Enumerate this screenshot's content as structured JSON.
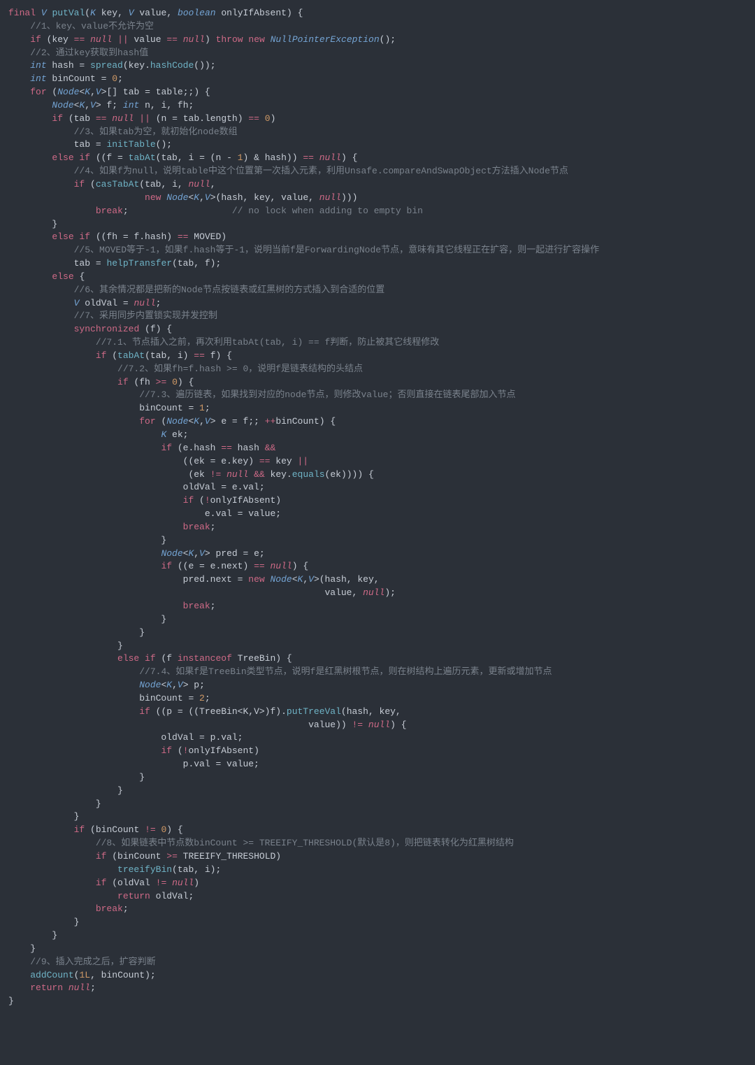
{
  "code_tokens": [
    [
      [
        "kw",
        "final"
      ],
      [
        "p",
        " "
      ],
      [
        "ty",
        "V"
      ],
      [
        "p",
        " "
      ],
      [
        "fn",
        "putVal"
      ],
      [
        "p",
        "("
      ],
      [
        "ty",
        "K"
      ],
      [
        "p",
        " key, "
      ],
      [
        "ty",
        "V"
      ],
      [
        "p",
        " value, "
      ],
      [
        "ty",
        "boolean"
      ],
      [
        "p",
        " onlyIfAbsent) {"
      ]
    ],
    [
      [
        "p",
        "    "
      ],
      [
        "cm",
        "//1、key、value不允许为空"
      ]
    ],
    [
      [
        "p",
        "    "
      ],
      [
        "kw",
        "if"
      ],
      [
        "p",
        " (key "
      ],
      [
        "op",
        "=="
      ],
      [
        "p",
        " "
      ],
      [
        "nul",
        "null"
      ],
      [
        "p",
        " "
      ],
      [
        "op",
        "||"
      ],
      [
        "p",
        " value "
      ],
      [
        "op",
        "=="
      ],
      [
        "p",
        " "
      ],
      [
        "nul",
        "null"
      ],
      [
        "p",
        ") "
      ],
      [
        "kw",
        "throw"
      ],
      [
        "p",
        " "
      ],
      [
        "kw",
        "new"
      ],
      [
        "p",
        " "
      ],
      [
        "ty",
        "NullPointerException"
      ],
      [
        "p",
        "();"
      ]
    ],
    [
      [
        "p",
        "    "
      ],
      [
        "cm",
        "//2、通过key获取到hash值"
      ]
    ],
    [
      [
        "p",
        "    "
      ],
      [
        "ty",
        "int"
      ],
      [
        "p",
        " hash = "
      ],
      [
        "fn",
        "spread"
      ],
      [
        "p",
        "(key."
      ],
      [
        "fn",
        "hashCode"
      ],
      [
        "p",
        "());"
      ]
    ],
    [
      [
        "p",
        "    "
      ],
      [
        "ty",
        "int"
      ],
      [
        "p",
        " binCount = "
      ],
      [
        "num",
        "0"
      ],
      [
        "p",
        ";"
      ]
    ],
    [
      [
        "p",
        "    "
      ],
      [
        "kw",
        "for"
      ],
      [
        "p",
        " ("
      ],
      [
        "ty",
        "Node"
      ],
      [
        "p",
        "<"
      ],
      [
        "ty",
        "K"
      ],
      [
        "p",
        ","
      ],
      [
        "ty",
        "V"
      ],
      [
        "p",
        ">[] tab = table;;) {"
      ]
    ],
    [
      [
        "p",
        "        "
      ],
      [
        "ty",
        "Node"
      ],
      [
        "p",
        "<"
      ],
      [
        "ty",
        "K"
      ],
      [
        "p",
        ","
      ],
      [
        "ty",
        "V"
      ],
      [
        "p",
        "> f; "
      ],
      [
        "ty",
        "int"
      ],
      [
        "p",
        " n, i, fh;"
      ]
    ],
    [
      [
        "p",
        "        "
      ],
      [
        "kw",
        "if"
      ],
      [
        "p",
        " (tab "
      ],
      [
        "op",
        "=="
      ],
      [
        "p",
        " "
      ],
      [
        "nul",
        "null"
      ],
      [
        "p",
        " "
      ],
      [
        "op",
        "||"
      ],
      [
        "p",
        " (n = tab.length) "
      ],
      [
        "op",
        "=="
      ],
      [
        "p",
        " "
      ],
      [
        "num",
        "0"
      ],
      [
        "p",
        ")"
      ]
    ],
    [
      [
        "p",
        "            "
      ],
      [
        "cm",
        "//3、如果tab为空，就初始化node数组"
      ]
    ],
    [
      [
        "p",
        "            tab = "
      ],
      [
        "fn",
        "initTable"
      ],
      [
        "p",
        "();"
      ]
    ],
    [
      [
        "p",
        "        "
      ],
      [
        "kw",
        "else if"
      ],
      [
        "p",
        " ((f = "
      ],
      [
        "fn",
        "tabAt"
      ],
      [
        "p",
        "(tab, i = (n - "
      ],
      [
        "num",
        "1"
      ],
      [
        "p",
        ") & hash)) "
      ],
      [
        "op",
        "=="
      ],
      [
        "p",
        " "
      ],
      [
        "nul",
        "null"
      ],
      [
        "p",
        ") {"
      ]
    ],
    [
      [
        "p",
        "            "
      ],
      [
        "cm",
        "//4、如果f为null，说明table中这个位置第一次插入元素，利用Unsafe.compareAndSwapObject方法插入Node节点"
      ]
    ],
    [
      [
        "p",
        "            "
      ],
      [
        "kw",
        "if"
      ],
      [
        "p",
        " ("
      ],
      [
        "fn",
        "casTabAt"
      ],
      [
        "p",
        "(tab, i, "
      ],
      [
        "nul",
        "null"
      ],
      [
        "p",
        ","
      ]
    ],
    [
      [
        "p",
        "                         "
      ],
      [
        "kw",
        "new"
      ],
      [
        "p",
        " "
      ],
      [
        "ty",
        "Node"
      ],
      [
        "p",
        "<"
      ],
      [
        "ty",
        "K"
      ],
      [
        "p",
        ","
      ],
      [
        "ty",
        "V"
      ],
      [
        "p",
        ">(hash, key, value, "
      ],
      [
        "nul",
        "null"
      ],
      [
        "p",
        ")))"
      ]
    ],
    [
      [
        "p",
        "                "
      ],
      [
        "kw",
        "break"
      ],
      [
        "p",
        ";                   "
      ],
      [
        "cm",
        "// no lock when adding to empty bin"
      ]
    ],
    [
      [
        "p",
        "        }"
      ]
    ],
    [
      [
        "p",
        "        "
      ],
      [
        "kw",
        "else if"
      ],
      [
        "p",
        " ((fh = f.hash) "
      ],
      [
        "op",
        "=="
      ],
      [
        "p",
        " MOVED)"
      ]
    ],
    [
      [
        "p",
        "            "
      ],
      [
        "cm",
        "//5、MOVED等于-1，如果f.hash等于-1，说明当前f是ForwardingNode节点，意味有其它线程正在扩容，则一起进行扩容操作"
      ]
    ],
    [
      [
        "p",
        "            tab = "
      ],
      [
        "fn",
        "helpTransfer"
      ],
      [
        "p",
        "(tab, f);"
      ]
    ],
    [
      [
        "p",
        "        "
      ],
      [
        "kw",
        "else"
      ],
      [
        "p",
        " {"
      ]
    ],
    [
      [
        "p",
        "            "
      ],
      [
        "cm",
        "//6、其余情况都是把新的Node节点按链表或红黑树的方式插入到合适的位置"
      ]
    ],
    [
      [
        "p",
        "            "
      ],
      [
        "ty",
        "V"
      ],
      [
        "p",
        " oldVal = "
      ],
      [
        "nul",
        "null"
      ],
      [
        "p",
        ";"
      ]
    ],
    [
      [
        "p",
        "            "
      ],
      [
        "cm",
        "//7、采用同步内置锁实现并发控制"
      ]
    ],
    [
      [
        "p",
        "            "
      ],
      [
        "kw",
        "synchronized"
      ],
      [
        "p",
        " (f) {"
      ]
    ],
    [
      [
        "p",
        "                "
      ],
      [
        "cm",
        "//7.1、节点插入之前，再次利用tabAt(tab, i) == f判断，防止被其它线程修改"
      ]
    ],
    [
      [
        "p",
        "                "
      ],
      [
        "kw",
        "if"
      ],
      [
        "p",
        " ("
      ],
      [
        "fn",
        "tabAt"
      ],
      [
        "p",
        "(tab, i) "
      ],
      [
        "op",
        "=="
      ],
      [
        "p",
        " f) {"
      ]
    ],
    [
      [
        "p",
        "                    "
      ],
      [
        "cm",
        "//7.2、如果fh=f.hash >= 0，说明f是链表结构的头结点"
      ]
    ],
    [
      [
        "p",
        "                    "
      ],
      [
        "kw",
        "if"
      ],
      [
        "p",
        " (fh "
      ],
      [
        "op",
        ">="
      ],
      [
        "p",
        " "
      ],
      [
        "num",
        "0"
      ],
      [
        "p",
        ") {"
      ]
    ],
    [
      [
        "p",
        "                        "
      ],
      [
        "cm",
        "//7.3、遍历链表，如果找到对应的node节点，则修改value；否则直接在链表尾部加入节点"
      ]
    ],
    [
      [
        "p",
        "                        binCount = "
      ],
      [
        "num",
        "1"
      ],
      [
        "p",
        ";"
      ]
    ],
    [
      [
        "p",
        "                        "
      ],
      [
        "kw",
        "for"
      ],
      [
        "p",
        " ("
      ],
      [
        "ty",
        "Node"
      ],
      [
        "p",
        "<"
      ],
      [
        "ty",
        "K"
      ],
      [
        "p",
        ","
      ],
      [
        "ty",
        "V"
      ],
      [
        "p",
        "> e = f;; "
      ],
      [
        "op",
        "++"
      ],
      [
        "p",
        "binCount) {"
      ]
    ],
    [
      [
        "p",
        "                            "
      ],
      [
        "ty",
        "K"
      ],
      [
        "p",
        " ek;"
      ]
    ],
    [
      [
        "p",
        "                            "
      ],
      [
        "kw",
        "if"
      ],
      [
        "p",
        " (e.hash "
      ],
      [
        "op",
        "=="
      ],
      [
        "p",
        " hash "
      ],
      [
        "op",
        "&&"
      ]
    ],
    [
      [
        "p",
        "                                ((ek = e.key) "
      ],
      [
        "op",
        "=="
      ],
      [
        "p",
        " key "
      ],
      [
        "op",
        "||"
      ]
    ],
    [
      [
        "p",
        "                                 (ek "
      ],
      [
        "op",
        "!="
      ],
      [
        "p",
        " "
      ],
      [
        "nul",
        "null"
      ],
      [
        "p",
        " "
      ],
      [
        "op",
        "&&"
      ],
      [
        "p",
        " key."
      ],
      [
        "fn",
        "equals"
      ],
      [
        "p",
        "(ek)))) {"
      ]
    ],
    [
      [
        "p",
        "                                oldVal = e.val;"
      ]
    ],
    [
      [
        "p",
        "                                "
      ],
      [
        "kw",
        "if"
      ],
      [
        "p",
        " ("
      ],
      [
        "op",
        "!"
      ],
      [
        "p",
        "onlyIfAbsent)"
      ]
    ],
    [
      [
        "p",
        "                                    e.val = value;"
      ]
    ],
    [
      [
        "p",
        "                                "
      ],
      [
        "kw",
        "break"
      ],
      [
        "p",
        ";"
      ]
    ],
    [
      [
        "p",
        "                            }"
      ]
    ],
    [
      [
        "p",
        "                            "
      ],
      [
        "ty",
        "Node"
      ],
      [
        "p",
        "<"
      ],
      [
        "ty",
        "K"
      ],
      [
        "p",
        ","
      ],
      [
        "ty",
        "V"
      ],
      [
        "p",
        "> pred = e;"
      ]
    ],
    [
      [
        "p",
        "                            "
      ],
      [
        "kw",
        "if"
      ],
      [
        "p",
        " ((e = e.next) "
      ],
      [
        "op",
        "=="
      ],
      [
        "p",
        " "
      ],
      [
        "nul",
        "null"
      ],
      [
        "p",
        ") {"
      ]
    ],
    [
      [
        "p",
        "                                pred.next = "
      ],
      [
        "kw",
        "new"
      ],
      [
        "p",
        " "
      ],
      [
        "ty",
        "Node"
      ],
      [
        "p",
        "<"
      ],
      [
        "ty",
        "K"
      ],
      [
        "p",
        ","
      ],
      [
        "ty",
        "V"
      ],
      [
        "p",
        ">(hash, key,"
      ]
    ],
    [
      [
        "p",
        "                                                          value, "
      ],
      [
        "nul",
        "null"
      ],
      [
        "p",
        ");"
      ]
    ],
    [
      [
        "p",
        "                                "
      ],
      [
        "kw",
        "break"
      ],
      [
        "p",
        ";"
      ]
    ],
    [
      [
        "p",
        "                            }"
      ]
    ],
    [
      [
        "p",
        "                        }"
      ]
    ],
    [
      [
        "p",
        "                    }"
      ]
    ],
    [
      [
        "p",
        "                    "
      ],
      [
        "kw",
        "else if"
      ],
      [
        "p",
        " (f "
      ],
      [
        "kw",
        "instanceof"
      ],
      [
        "p",
        " TreeBin) {"
      ]
    ],
    [
      [
        "p",
        "                        "
      ],
      [
        "cm",
        "//7.4、如果f是TreeBin类型节点，说明f是红黑树根节点，则在树结构上遍历元素，更新或增加节点"
      ]
    ],
    [
      [
        "p",
        "                        "
      ],
      [
        "ty",
        "Node"
      ],
      [
        "p",
        "<"
      ],
      [
        "ty",
        "K"
      ],
      [
        "p",
        ","
      ],
      [
        "ty",
        "V"
      ],
      [
        "p",
        "> p;"
      ]
    ],
    [
      [
        "p",
        "                        binCount = "
      ],
      [
        "num",
        "2"
      ],
      [
        "p",
        ";"
      ]
    ],
    [
      [
        "p",
        "                        "
      ],
      [
        "kw",
        "if"
      ],
      [
        "p",
        " ((p = ((TreeBin<K,V>)f)."
      ],
      [
        "fn",
        "putTreeVal"
      ],
      [
        "p",
        "(hash, key,"
      ]
    ],
    [
      [
        "p",
        "                                                       value)) "
      ],
      [
        "op",
        "!="
      ],
      [
        "p",
        " "
      ],
      [
        "nul",
        "null"
      ],
      [
        "p",
        ") {"
      ]
    ],
    [
      [
        "p",
        "                            oldVal = p.val;"
      ]
    ],
    [
      [
        "p",
        "                            "
      ],
      [
        "kw",
        "if"
      ],
      [
        "p",
        " ("
      ],
      [
        "op",
        "!"
      ],
      [
        "p",
        "onlyIfAbsent)"
      ]
    ],
    [
      [
        "p",
        "                                p.val = value;"
      ]
    ],
    [
      [
        "p",
        "                        }"
      ]
    ],
    [
      [
        "p",
        "                    }"
      ]
    ],
    [
      [
        "p",
        "                }"
      ]
    ],
    [
      [
        "p",
        "            }"
      ]
    ],
    [
      [
        "p",
        "            "
      ],
      [
        "kw",
        "if"
      ],
      [
        "p",
        " (binCount "
      ],
      [
        "op",
        "!="
      ],
      [
        "p",
        " "
      ],
      [
        "num",
        "0"
      ],
      [
        "p",
        ") {"
      ]
    ],
    [
      [
        "p",
        "                "
      ],
      [
        "cm",
        "//8、如果链表中节点数binCount >= TREEIFY_THRESHOLD(默认是8)，则把链表转化为红黑树结构"
      ]
    ],
    [
      [
        "p",
        "                "
      ],
      [
        "kw",
        "if"
      ],
      [
        "p",
        " (binCount "
      ],
      [
        "op",
        ">="
      ],
      [
        "p",
        " TREEIFY_THRESHOLD)"
      ]
    ],
    [
      [
        "p",
        "                    "
      ],
      [
        "fn",
        "treeifyBin"
      ],
      [
        "p",
        "(tab, i);"
      ]
    ],
    [
      [
        "p",
        "                "
      ],
      [
        "kw",
        "if"
      ],
      [
        "p",
        " (oldVal "
      ],
      [
        "op",
        "!="
      ],
      [
        "p",
        " "
      ],
      [
        "nul",
        "null"
      ],
      [
        "p",
        ")"
      ]
    ],
    [
      [
        "p",
        "                    "
      ],
      [
        "kw",
        "return"
      ],
      [
        "p",
        " oldVal;"
      ]
    ],
    [
      [
        "p",
        "                "
      ],
      [
        "kw",
        "break"
      ],
      [
        "p",
        ";"
      ]
    ],
    [
      [
        "p",
        "            }"
      ]
    ],
    [
      [
        "p",
        "        }"
      ]
    ],
    [
      [
        "p",
        "    }"
      ]
    ],
    [
      [
        "p",
        "    "
      ],
      [
        "cm",
        "//9、插入完成之后，扩容判断"
      ]
    ],
    [
      [
        "p",
        "    "
      ],
      [
        "fn",
        "addCount"
      ],
      [
        "p",
        "("
      ],
      [
        "num",
        "1L"
      ],
      [
        "p",
        ", binCount);"
      ]
    ],
    [
      [
        "p",
        "    "
      ],
      [
        "kw",
        "return"
      ],
      [
        "p",
        " "
      ],
      [
        "nul",
        "null"
      ],
      [
        "p",
        ";"
      ]
    ],
    [
      [
        "p",
        "}"
      ]
    ]
  ]
}
